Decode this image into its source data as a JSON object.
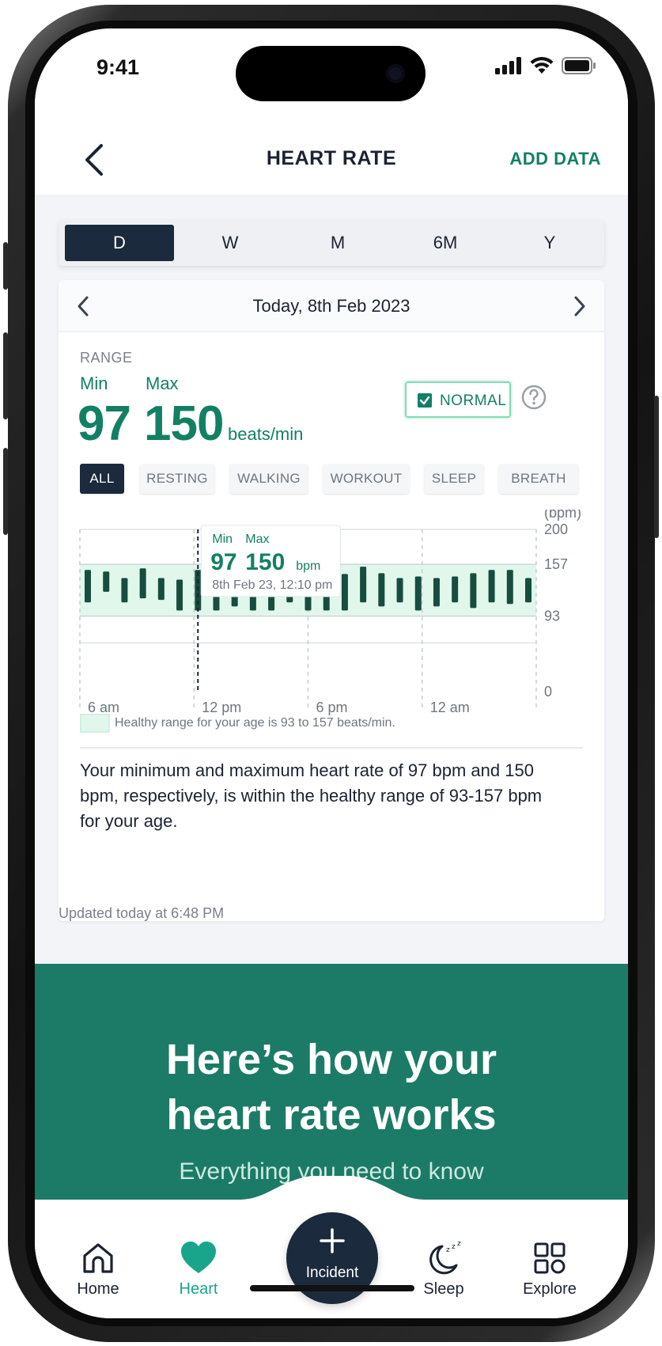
{
  "status_bar": {
    "time": "9:41"
  },
  "header": {
    "title": "HEART RATE",
    "action_label": "ADD DATA"
  },
  "period_tabs": [
    "D",
    "W",
    "M",
    "6M",
    "Y"
  ],
  "period_selected": "D",
  "date_nav": {
    "label": "Today, 8th Feb 2023"
  },
  "range": {
    "label": "RANGE",
    "min_label": "Min",
    "max_label": "Max",
    "min_value": "97",
    "max_value": "150",
    "unit": "beats/min",
    "status": "NORMAL"
  },
  "filters": [
    "ALL",
    "RESTING",
    "WALKING",
    "WORKOUT",
    "SLEEP",
    "BREATH"
  ],
  "filter_selected": "ALL",
  "chart_data": {
    "type": "bar",
    "ylabel": "(bpm)",
    "ylim": [
      0,
      200
    ],
    "y_ticks": [
      "200",
      "157",
      "93",
      "0"
    ],
    "x_ticks": [
      "6 am",
      "12 pm",
      "6 pm",
      "12 am"
    ],
    "healthy_range": [
      93,
      157
    ],
    "series": [
      {
        "ranges": [
          [
            110,
            150
          ],
          [
            123,
            148
          ],
          [
            110,
            140
          ],
          [
            115,
            152
          ],
          [
            113,
            140
          ],
          [
            100,
            138
          ],
          [
            100,
            150
          ],
          [
            100,
            142
          ],
          [
            105,
            132
          ],
          [
            100,
            135
          ],
          [
            100,
            148
          ],
          [
            110,
            142
          ],
          [
            100,
            142
          ],
          [
            100,
            145
          ],
          [
            100,
            145
          ],
          [
            110,
            154
          ],
          [
            105,
            146
          ],
          [
            110,
            140
          ],
          [
            100,
            142
          ],
          [
            105,
            140
          ],
          [
            110,
            142
          ],
          [
            103,
            146
          ],
          [
            110,
            150
          ],
          [
            108,
            150
          ],
          [
            110,
            140
          ]
        ]
      }
    ],
    "tooltip": {
      "min_label": "Min",
      "max_label": "Max",
      "min_value": "97",
      "max_value": "150",
      "unit": "bpm",
      "datetime": "8th Feb 23, 12:10 pm"
    }
  },
  "legend": {
    "text": "Healthy range for your age is 93 to 157 beats/min."
  },
  "summary": "Your minimum and maximum heart rate of 97 bpm and 150 bpm, respectively, is within the healthy range of 93-157 bpm for your age.",
  "updated": "Updated today at 6:48 PM",
  "info_banner": {
    "title_line1": "Here’s how your",
    "title_line2": "heart rate works",
    "subtitle": "Everything you need to know"
  },
  "bottom_nav": {
    "items": [
      {
        "label": "Home",
        "icon": "home-icon"
      },
      {
        "label": "Heart",
        "icon": "heart-icon"
      },
      {
        "label": "Sleep",
        "icon": "sleep-icon"
      },
      {
        "label": "Explore",
        "icon": "grid-icon"
      }
    ],
    "fab_label": "Incident",
    "active": "Heart"
  },
  "colors": {
    "accent": "#138064",
    "navy": "#1b2a3c",
    "bar": "#174d3e",
    "healthy_band": "#e1f7ec",
    "banner": "#1b7b67",
    "nav_active": "#18a58c"
  }
}
